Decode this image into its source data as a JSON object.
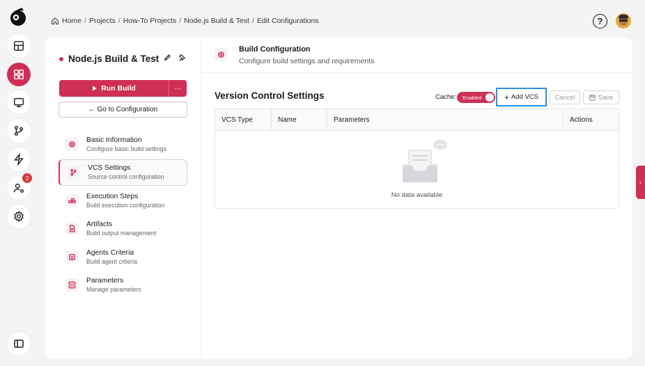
{
  "breadcrumb": {
    "items": [
      "Home",
      "Projects",
      "How-To Projects",
      "Node.js Build & Test",
      "Edit Configurations"
    ]
  },
  "nav": {
    "badge_count": "2"
  },
  "project": {
    "title": "Node.js Build & Test",
    "run_label": "Run Build",
    "more_label": "···",
    "goto_label": "← Go to Configuration"
  },
  "menu": [
    {
      "title": "Basic Information",
      "subtitle": "Configure basic build settings",
      "icon": "gear-icon"
    },
    {
      "title": "VCS Settings",
      "subtitle": "Source control configuration",
      "icon": "branch-icon"
    },
    {
      "title": "Execution Steps",
      "subtitle": "Build execution configuration",
      "icon": "steps-icon"
    },
    {
      "title": "Artifacts",
      "subtitle": "Build output management",
      "icon": "file-icon"
    },
    {
      "title": "Agents Criteria",
      "subtitle": "Build agent criteria",
      "icon": "agent-icon"
    },
    {
      "title": "Parameters",
      "subtitle": "Manage parameters",
      "icon": "params-icon"
    }
  ],
  "header": {
    "title": "Build Configuration",
    "subtitle": "Configure build settings and requirements"
  },
  "vcs": {
    "title": "Version Control Settings",
    "cache_label": "Cache:",
    "cache_state": "Enabled",
    "add_label": "Add VCS",
    "cancel_label": "Cancel",
    "save_label": "Save",
    "columns": [
      "VCS Type",
      "Name",
      "Parameters",
      "Actions"
    ],
    "empty_text": "No data available"
  },
  "colors": {
    "accent": "#cf2f55",
    "focus": "#2d8ee6"
  }
}
